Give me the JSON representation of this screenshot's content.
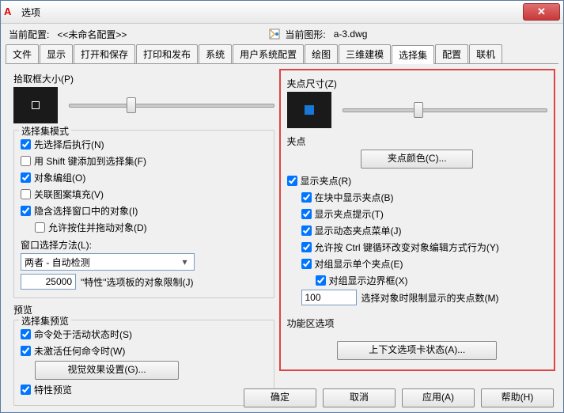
{
  "titlebar": {
    "title": "选项",
    "close": "✕"
  },
  "header": {
    "profile_label": "当前配置:",
    "profile_value": "<<未命名配置>>",
    "drawing_label": "当前图形:",
    "drawing_value": "a-3.dwg"
  },
  "tabs": [
    "文件",
    "显示",
    "打开和保存",
    "打印和发布",
    "系统",
    "用户系统配置",
    "绘图",
    "三维建模",
    "选择集",
    "配置",
    "联机"
  ],
  "active_tab": 8,
  "left": {
    "pickbox_label": "拾取框大小(P)",
    "sel_mode": "选择集模式",
    "chk": {
      "noun_verb": "先选择后执行(N)",
      "shift_add": "用 Shift 键添加到选择集(F)",
      "obj_group": "对象编组(O)",
      "assoc_hatch": "关联图案填充(V)",
      "implied_win": "隐含选择窗口中的对象(I)",
      "allow_press": "允许按住并拖动对象(D)"
    },
    "win_method_label": "窗口选择方法(L):",
    "win_method_value": "两者 - 自动检测",
    "prop_limit_value": "25000",
    "prop_limit_label": "\"特性\"选项板的对象限制(J)",
    "preview": "预览",
    "sel_preview": "选择集预览",
    "chk2": {
      "cmd_active": "命令处于活动状态时(S)",
      "no_cmd": "未激活任何命令时(W)",
      "prop_preview": "特性预览"
    },
    "vis_btn": "视觉效果设置(G)..."
  },
  "right": {
    "grip_size_label": "夹点尺寸(Z)",
    "grips": "夹点",
    "grip_color_btn": "夹点颜色(C)...",
    "chk": {
      "show_grips": "显示夹点(R)",
      "in_block": "在块中显示夹点(B)",
      "grip_tips": "显示夹点提示(T)",
      "dyn_menu": "显示动态夹点菜单(J)",
      "ctrl_cycle": "允许按 Ctrl 键循环改变对象编辑方式行为(Y)",
      "group_single": "对组显示单个夹点(E)",
      "group_bbox": "对组显示边界框(X)"
    },
    "grip_limit_value": "100",
    "grip_limit_label": "选择对象时限制显示的夹点数(M)",
    "ribbon": "功能区选项",
    "ctx_btn": "上下文选项卡状态(A)..."
  },
  "buttons": {
    "ok": "确定",
    "cancel": "取消",
    "apply": "应用(A)",
    "help": "帮助(H)"
  }
}
